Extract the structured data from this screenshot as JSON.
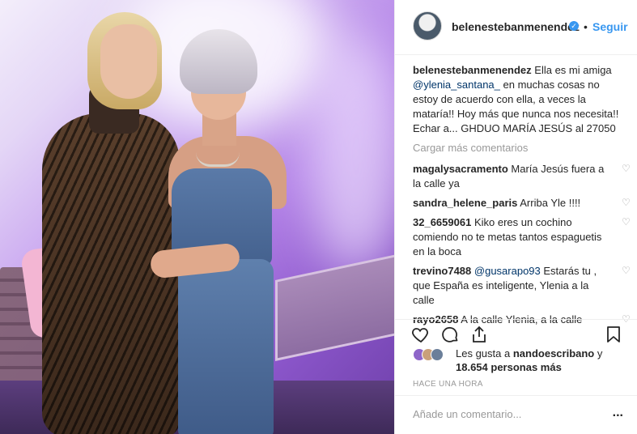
{
  "post": {
    "username": "belenestebanmenendez",
    "verified_icon": "verified-badge-icon",
    "separator": "•",
    "follow_label": "Seguir"
  },
  "caption": {
    "username": "belenestebanmenendez",
    "text_before": "Ella es mi amiga",
    "mention": "@ylenia_santana_",
    "text_after": "en muchas cosas no estoy de acuerdo con ella, a veces la mataría!! Hoy más que nunca nos necesita!! Echar a... GHDUO MARÍA JESÚS al 27050"
  },
  "load_more": "Cargar más comentarios",
  "comments": [
    {
      "user": "magalysacramento",
      "text": "María Jesús fuera a la calle ya"
    },
    {
      "user": "sandra_helene_paris",
      "text": "Arriba Yle !!!!"
    },
    {
      "user": "32_6659061",
      "text": "Kiko eres un cochino comiendo no te metas tantos espaguetis en la boca"
    },
    {
      "user": "trevino7488",
      "mention": "@gusarapo93",
      "text": "Estarás tu , que España es inteligente, Ylenia a la calle"
    },
    {
      "user": "rayo2658",
      "text": "A la calle Ylenia, a la calle"
    }
  ],
  "actions": {
    "like_icon": "heart-icon",
    "comment_icon": "comment-bubble-icon",
    "share_icon": "share-icon",
    "save_icon": "bookmark-icon"
  },
  "likes": {
    "prefix": "Les gusta a",
    "user": "nandoescribano",
    "connector": "y",
    "count": "18.654 personas más"
  },
  "timestamp": "HACE UNA HORA",
  "add_comment": {
    "placeholder": "Añade un comentario...",
    "options_label": "..."
  },
  "colors": {
    "link_blue": "#3897f0",
    "mention_blue": "#003569",
    "muted_gray": "#999999",
    "text": "#262626"
  }
}
